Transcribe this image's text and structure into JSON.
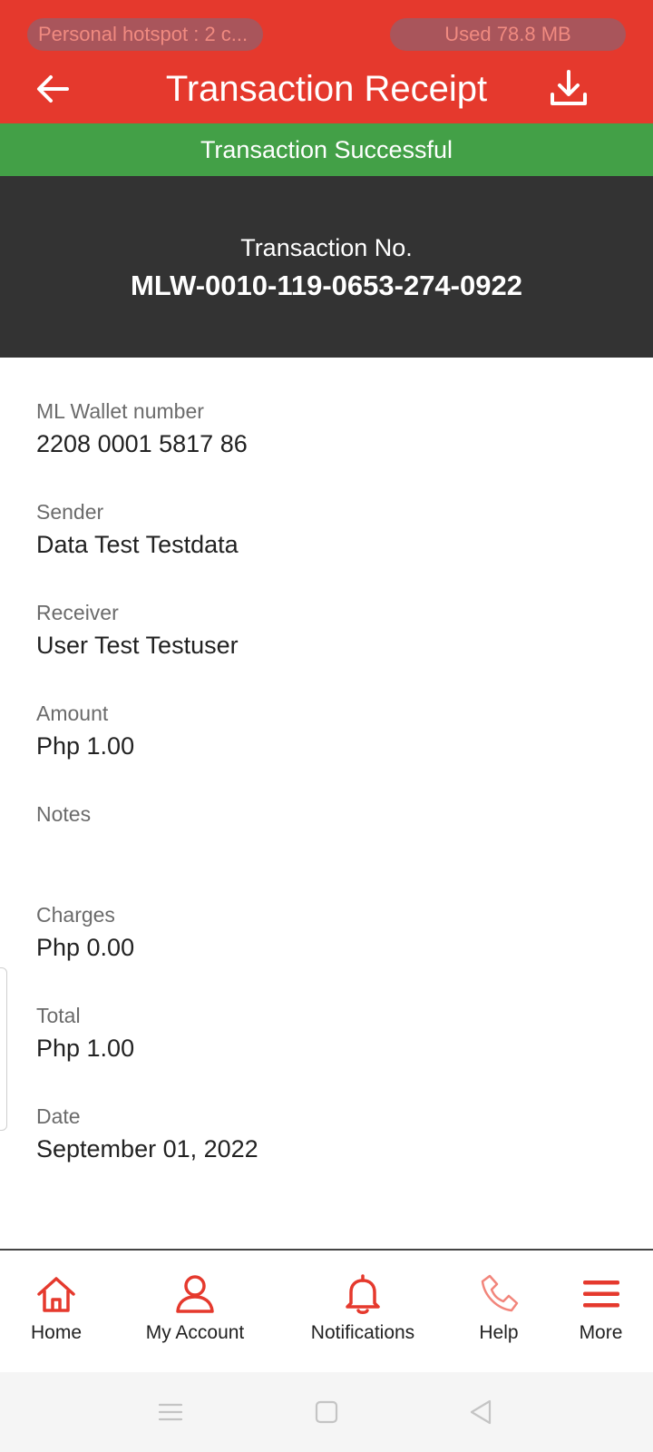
{
  "status_bar": {
    "hotspot": "Personal hotspot : 2 c...",
    "data_used": "Used  78.8 MB"
  },
  "header": {
    "title": "Transaction Receipt",
    "back_icon": "arrow-left-icon",
    "download_icon": "download-icon"
  },
  "banner": {
    "text": "Transaction Successful"
  },
  "transaction": {
    "label": "Transaction No.",
    "number": "MLW-0010-119-0653-274-0922"
  },
  "details": [
    {
      "label": "ML Wallet number",
      "value": "2208 0001 5817 86"
    },
    {
      "label": "Sender",
      "value": "Data Test Testdata"
    },
    {
      "label": "Receiver",
      "value": "User Test Testuser"
    },
    {
      "label": "Amount",
      "value": "Php 1.00"
    },
    {
      "label": "Notes",
      "value": ""
    },
    {
      "label": "Charges",
      "value": "Php 0.00"
    },
    {
      "label": "Total",
      "value": "Php 1.00"
    },
    {
      "label": "Date",
      "value": "September 01, 2022"
    }
  ],
  "bottom_nav": [
    {
      "label": "Home",
      "icon": "home-icon"
    },
    {
      "label": "My Account",
      "icon": "user-icon"
    },
    {
      "label": "Notifications",
      "icon": "bell-icon"
    },
    {
      "label": "Help",
      "icon": "phone-icon"
    },
    {
      "label": "More",
      "icon": "menu-icon"
    }
  ],
  "colors": {
    "brand_red": "#e5392d",
    "success_green": "#43a047",
    "dark_panel": "#333333"
  }
}
